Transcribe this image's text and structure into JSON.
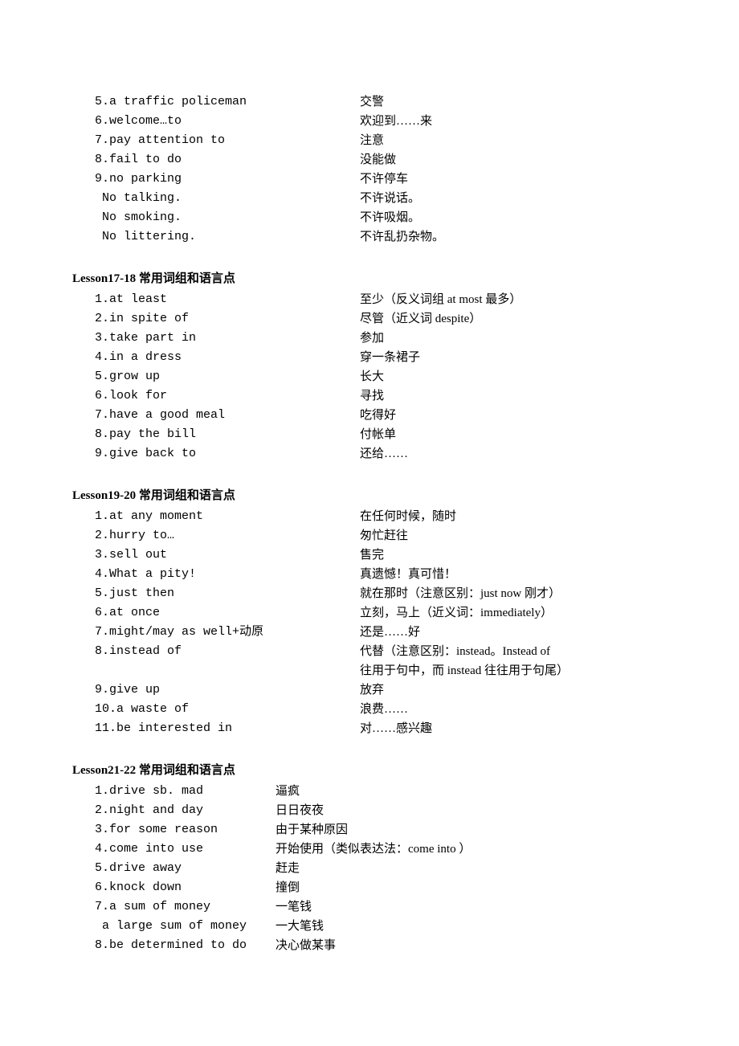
{
  "continuation_items": [
    {
      "en": "5.a traffic policeman",
      "cn": "交警"
    },
    {
      "en": "6.welcome…to",
      "cn": "欢迎到……来"
    },
    {
      "en": "7.pay attention to",
      "cn": "注意"
    },
    {
      "en": "8.fail to do",
      "cn": "没能做"
    },
    {
      "en": "9.no parking",
      "cn": "不许停车"
    },
    {
      "en": " No talking.",
      "cn": "不许说话。"
    },
    {
      "en": " No smoking.",
      "cn": "不许吸烟。"
    },
    {
      "en": " No littering.",
      "cn": "不许乱扔杂物。"
    }
  ],
  "sections": [
    {
      "title": "Lesson17-18 常用词组和语言点",
      "narrow": false,
      "items": [
        {
          "en": "1.at least",
          "cn": "至少（反义词组 at most 最多）"
        },
        {
          "en": "2.in spite of",
          "cn": "尽管（近义词 despite）"
        },
        {
          "en": "3.take part in",
          "cn": "参加"
        },
        {
          "en": "4.in a dress",
          "cn": "穿一条裙子"
        },
        {
          "en": "5.grow up",
          "cn": "长大"
        },
        {
          "en": "6.look for",
          "cn": "寻找"
        },
        {
          "en": "7.have a good meal",
          "cn": "吃得好"
        },
        {
          "en": "8.pay the bill",
          "cn": "付帐单"
        },
        {
          "en": "9.give back to",
          "cn": "还给……"
        }
      ]
    },
    {
      "title": "Lesson19-20 常用词组和语言点",
      "narrow": false,
      "items": [
        {
          "en": "1.at any moment",
          "cn": "在任何时候，随时"
        },
        {
          "en": "2.hurry to…",
          "cn": "匆忙赶往"
        },
        {
          "en": "3.sell out",
          "cn": "售完"
        },
        {
          "en": "4.What a pity!",
          "cn": "真遗憾！真可惜！"
        },
        {
          "en": "5.just then",
          "cn": "就在那时（注意区别：just now 刚才）"
        },
        {
          "en": "6.at once",
          "cn": "立刻，马上（近义词：immediately）"
        },
        {
          "en": "7.might/may as well+动原",
          "cn": "还是……好"
        },
        {
          "en": "8.instead of",
          "cn": "代替（注意区别：instead。Instead of"
        },
        {
          "en": "",
          "cn": "往用于句中，而 instead 往往用于句尾）"
        },
        {
          "en": "9.give up",
          "cn": "放弃"
        },
        {
          "en": "10.a waste of",
          "cn": "浪费……"
        },
        {
          "en": "11.be interested in",
          "cn": "对……感兴趣"
        }
      ]
    },
    {
      "title": "Lesson21-22 常用词组和语言点",
      "narrow": true,
      "items": [
        {
          "en": "1.drive sb. mad",
          "cn": "逼疯"
        },
        {
          "en": "2.night and day",
          "cn": "日日夜夜"
        },
        {
          "en": "3.for some reason",
          "cn": "由于某种原因"
        },
        {
          "en": "4.come into use",
          "cn": "开始使用（类似表达法：come into ）"
        },
        {
          "en": "5.drive away",
          "cn": "赶走"
        },
        {
          "en": "6.knock down",
          "cn": "撞倒"
        },
        {
          "en": "7.a sum of money",
          "cn": "一笔钱"
        },
        {
          "en": " a large sum of money",
          "cn": "一大笔钱"
        },
        {
          "en": "8.be determined to do",
          "cn": "决心做某事"
        }
      ]
    }
  ]
}
